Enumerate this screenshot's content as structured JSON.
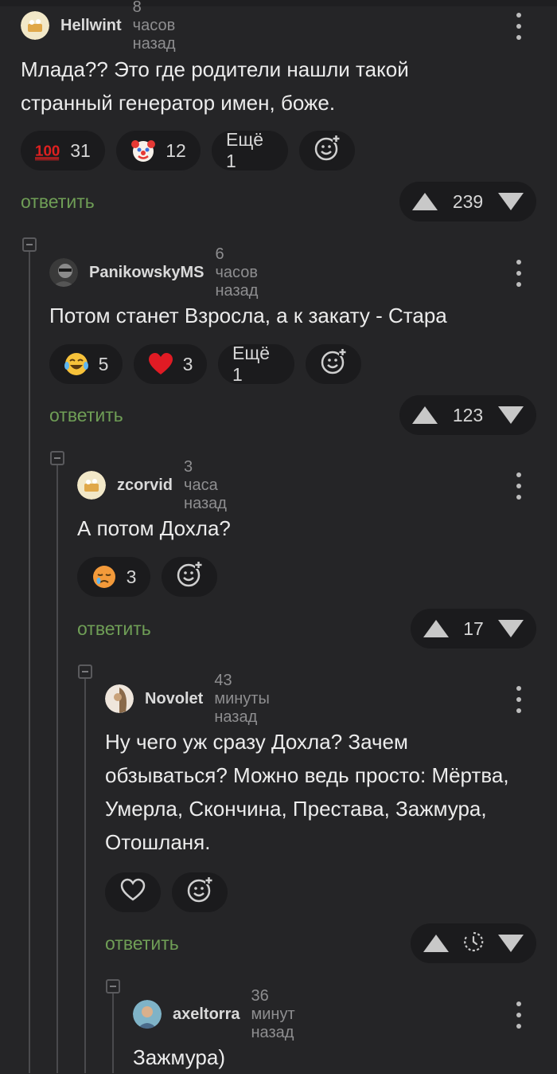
{
  "colors": {
    "background": "#252527",
    "chip": "#1b1b1d",
    "reply": "#6f9e56",
    "muted": "#8e8e90"
  },
  "comments": [
    {
      "author": "Hellwint",
      "time": "8 часов назад",
      "text": "Млада?? Это где родители нашли такой странный генератор имен, боже.",
      "reactions": [
        {
          "icon": "100-emoji-icon",
          "count": "31"
        },
        {
          "icon": "clown-emoji-icon",
          "count": "12"
        }
      ],
      "more": "Ещё 1",
      "reply": "ответить",
      "rating": "239"
    },
    {
      "author": "PanikowskyMS",
      "time": "6 часов назад",
      "text": "Потом станет Взросла, а к закату - Стара",
      "reactions": [
        {
          "icon": "tears-of-joy-emoji-icon",
          "count": "5"
        },
        {
          "icon": "red-heart-emoji-icon",
          "count": "3"
        }
      ],
      "more": "Ещё 1",
      "reply": "ответить",
      "rating": "123"
    },
    {
      "author": "zcorvid",
      "time": "3 часа назад",
      "text": "А потом Дохла?",
      "reactions": [
        {
          "icon": "sad-relieved-emoji-icon",
          "count": "3"
        }
      ],
      "reply": "ответить",
      "rating": "17"
    },
    {
      "author": "Novolet",
      "time": "43 минуты назад",
      "text": "Ну чего уж сразу Дохла? Зачем обзываться? Можно ведь просто: Мёртва, Умерла, Скончина, Престава, Зажмура, Отошланя.",
      "reply": "ответить",
      "rating_state": "pending-clock-icon"
    },
    {
      "author": "axeltorra",
      "time": "36 минут назад",
      "text": "Зажмура)"
    }
  ]
}
